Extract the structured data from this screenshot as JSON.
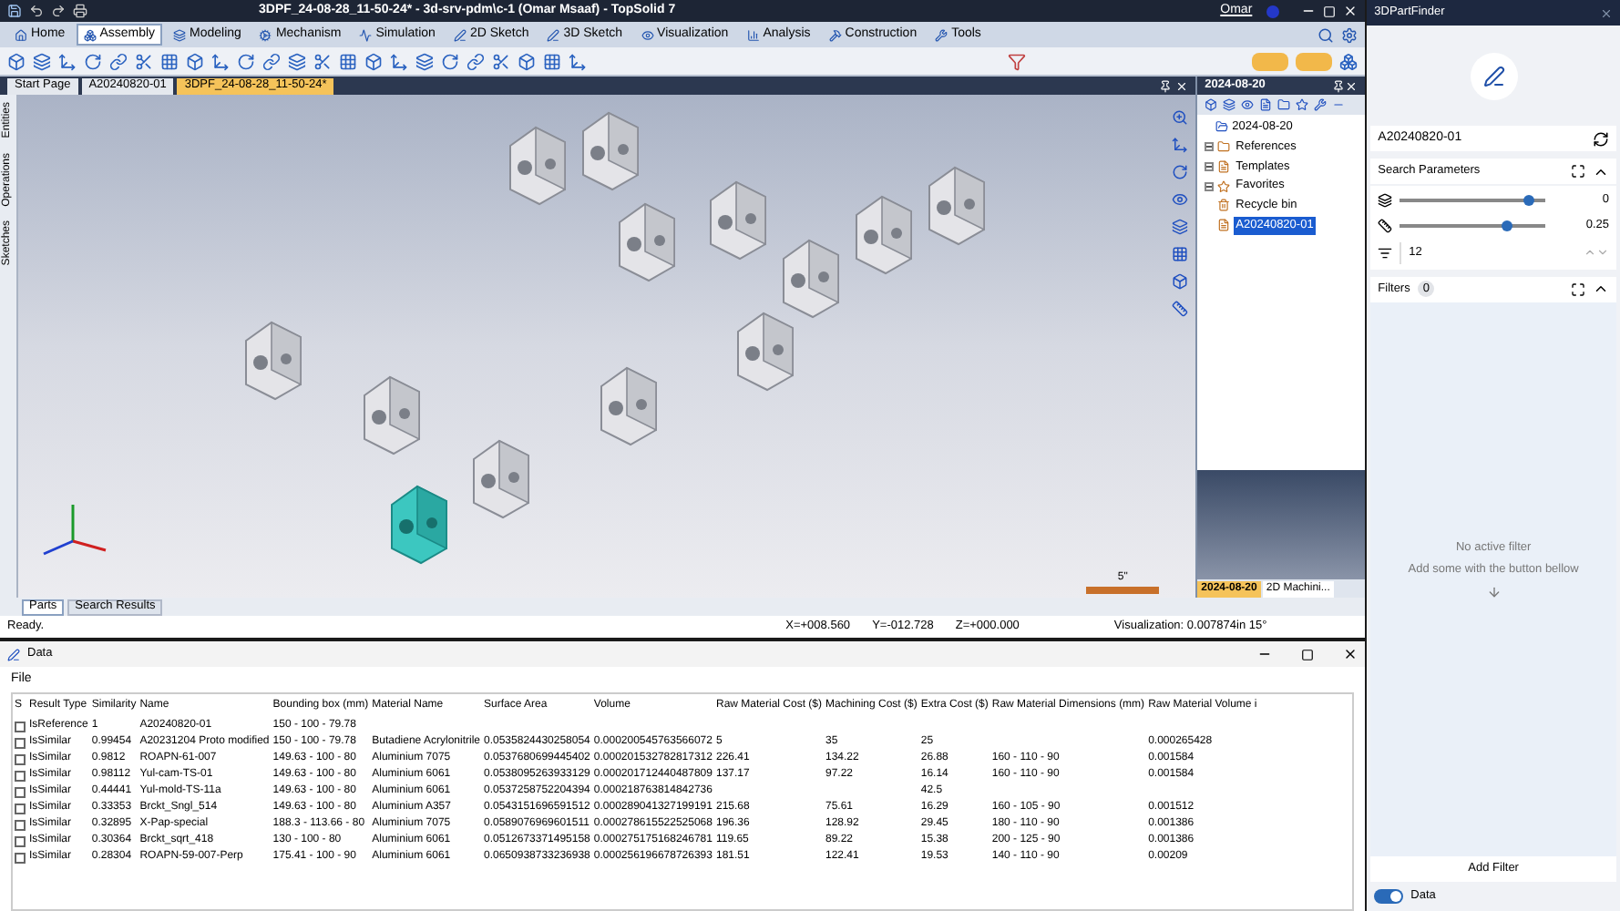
{
  "window": {
    "title": "3DPF_24-08-28_11-50-24* - 3d-srv-pdm\\c-1 (Omar Msaaf) - TopSolid 7",
    "user": "Omar"
  },
  "ribbon_tabs": [
    {
      "label": "Home",
      "selected": false
    },
    {
      "label": "Assembly",
      "selected": true
    },
    {
      "label": "Modeling",
      "selected": false
    },
    {
      "label": "Mechanism",
      "selected": false
    },
    {
      "label": "Simulation",
      "selected": false
    },
    {
      "label": "2D Sketch",
      "selected": false
    },
    {
      "label": "3D Sketch",
      "selected": false
    },
    {
      "label": "Visualization",
      "selected": false
    },
    {
      "label": "Analysis",
      "selected": false
    },
    {
      "label": "Construction",
      "selected": false
    },
    {
      "label": "Tools",
      "selected": false
    }
  ],
  "document_tabs": [
    {
      "label": "Start Page",
      "selected": false
    },
    {
      "label": "A20240820-01",
      "selected": false
    },
    {
      "label": "3DPF_24-08-28_11-50-24*",
      "selected": true
    }
  ],
  "side_tabs": [
    "Entities",
    "Operations",
    "Sketches"
  ],
  "viewport": {
    "scale_label": "5\""
  },
  "project_panel": {
    "title": "2024-08-20",
    "root": "2024-08-20",
    "items": [
      {
        "label": "References",
        "collapsed": true,
        "selected": false
      },
      {
        "label": "Templates",
        "collapsed": true,
        "selected": false
      },
      {
        "label": "Favorites",
        "collapsed": true,
        "selected": false
      },
      {
        "label": "Recycle bin",
        "collapsed": false,
        "selected": false
      },
      {
        "label": "A20240820-01",
        "collapsed": false,
        "selected": true
      }
    ],
    "tabs": [
      {
        "label": "2024-08-20",
        "selected": true
      },
      {
        "label": "2D Machini...",
        "selected": false
      }
    ]
  },
  "bottom_tabs": [
    {
      "label": "Parts",
      "selected": true
    },
    {
      "label": "Search Results",
      "selected": false
    }
  ],
  "status_bar": {
    "message": "Ready.",
    "x": "X=+008.560",
    "y": "Y=-012.728",
    "z": "Z=+000.000",
    "visualization": "Visualization: 0.007874in 15°"
  },
  "data_window": {
    "title": "Data",
    "menu": [
      "File"
    ],
    "table": {
      "columns": [
        "S",
        "Result Type",
        "Similarity",
        "Name",
        "Bounding box (mm)",
        "Material Name",
        "Surface Area",
        "Volume",
        "Raw Material Cost ($)",
        "Machining Cost ($)",
        "Extra Cost ($)",
        "Raw Material Dimensions (mm)",
        "Raw Material Volume i"
      ],
      "rows": [
        {
          "checked": false,
          "cells": [
            "",
            "IsReference",
            "1",
            "A20240820-01",
            "150 - 100 - 79.78",
            "",
            "",
            "",
            "",
            "",
            "",
            "",
            ""
          ]
        },
        {
          "checked": false,
          "cells": [
            "",
            "IsSimilar",
            "0.99454",
            "A20231204 Proto modified",
            "150 - 100 - 79.78",
            "Butadiene Acrylonitrile",
            "0.0535824430258054",
            "0.000200545763566072",
            "5",
            "35",
            "25",
            "",
            "0.000265428"
          ]
        },
        {
          "checked": false,
          "cells": [
            "",
            "IsSimilar",
            "0.9812",
            "ROAPN-61-007",
            "149.63 - 100 - 80",
            "Aluminium 7075",
            "0.0537680699445402",
            "0.000201532782817312",
            "226.41",
            "134.22",
            "26.88",
            "160 - 110 - 90",
            "0.001584"
          ]
        },
        {
          "checked": false,
          "cells": [
            "",
            "IsSimilar",
            "0.98112",
            "Yul-cam-TS-01",
            "149.63 - 100 - 80",
            "Aluminium 6061",
            "0.0538095263933129",
            "0.000201712440487809",
            "137.17",
            "97.22",
            "16.14",
            "160 - 110 - 90",
            "0.001584"
          ]
        },
        {
          "checked": false,
          "cells": [
            "",
            "IsSimilar",
            "0.44441",
            "Yul-mold-TS-11a",
            "149.63 - 100 - 80",
            "Aluminium 6061",
            "0.0537258752204394",
            "0.000218763814842736",
            "",
            "",
            "42.5",
            "",
            ""
          ]
        },
        {
          "checked": false,
          "cells": [
            "",
            "IsSimilar",
            "0.33353",
            "Brckt_Sngl_514",
            "149.63 - 100 - 80",
            "Aluminium A357",
            "0.0543151696591512",
            "0.000289041327199191",
            "215.68",
            "75.61",
            "16.29",
            "160 - 105 - 90",
            "0.001512"
          ]
        },
        {
          "checked": false,
          "cells": [
            "",
            "IsSimilar",
            "0.32895",
            "X-Pap-special",
            "188.3 - 113.66 - 80",
            "Aluminium 7075",
            "0.0589076969601511",
            "0.000278615522525068",
            "196.36",
            "128.92",
            "29.45",
            "180 - 110 - 90",
            "0.001386"
          ]
        },
        {
          "checked": false,
          "cells": [
            "",
            "IsSimilar",
            "0.30364",
            "Brckt_sqrt_418",
            "130 - 100 - 80",
            "Aluminium 6061",
            "0.0512673371495158",
            "0.000275175168246781",
            "119.65",
            "89.22",
            "15.38",
            "200 - 125 - 90",
            "0.001386"
          ]
        },
        {
          "checked": false,
          "cells": [
            "",
            "IsSimilar",
            "0.28304",
            "ROAPN-59-007-Perp",
            "175.41 - 100 - 90",
            "Aluminium 6061",
            "0.0650938733236938",
            "0.000256196678726393",
            "181.51",
            "122.41",
            "19.53",
            "140 - 110 - 90",
            "0.00209"
          ]
        }
      ]
    }
  },
  "finder": {
    "title": "3DPartFinder",
    "reference": "A20240820-01",
    "search_parameters": {
      "title": "Search Parameters",
      "sliders": [
        {
          "level": 0.88,
          "reading": "0"
        },
        {
          "level": 0.74,
          "reading": "0.25"
        }
      ],
      "count": "12"
    },
    "filters": {
      "title": "Filters",
      "count": "0",
      "empty_title": "No active filter",
      "empty_hint": "Add some with the button bellow"
    },
    "add_filter": "Add Filter",
    "data_toggle": {
      "label": "Data",
      "on": true
    }
  }
}
